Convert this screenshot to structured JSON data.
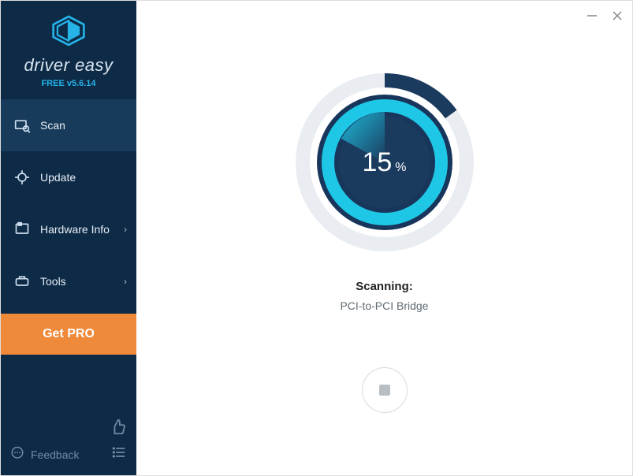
{
  "brand": {
    "name": "driver easy",
    "version": "FREE v5.6.14"
  },
  "sidebar": {
    "items": [
      {
        "label": "Scan"
      },
      {
        "label": "Update"
      },
      {
        "label": "Hardware Info"
      },
      {
        "label": "Tools"
      }
    ],
    "get_pro": "Get PRO",
    "feedback": "Feedback"
  },
  "scan": {
    "percent": "15",
    "percent_unit": "%",
    "status_label": "Scanning:",
    "current_item": "PCI-to-PCI Bridge"
  },
  "colors": {
    "sidebar_bg": "#0d2a47",
    "accent_cyan": "#1fc7e6",
    "accent_orange": "#f08a3b",
    "ring_dark": "#18365b"
  }
}
